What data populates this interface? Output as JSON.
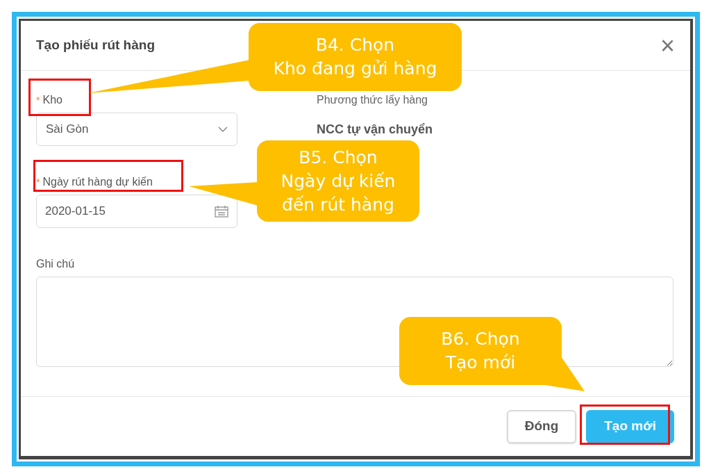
{
  "dialog": {
    "title": "Tạo phiếu rút hàng",
    "close": "×"
  },
  "fields": {
    "warehouse": {
      "required_mark": "*",
      "label": "Kho",
      "value": "Sài Gòn"
    },
    "method": {
      "label": "Phương thức lấy hàng",
      "value": "NCC tự vận chuyển"
    },
    "date": {
      "required_mark": "*",
      "label": "Ngày rút hàng dự kiến",
      "value": "2020-01-15"
    },
    "note": {
      "label": "Ghi chú"
    }
  },
  "buttons": [
    {
      "label": "Đóng",
      "kind": "secondary"
    },
    {
      "label": "Tạo mới",
      "kind": "primary"
    }
  ],
  "callouts": [
    {
      "lines": [
        "B4. Chọn",
        "Kho đang gửi hàng"
      ]
    },
    {
      "lines": [
        "B5. Chọn",
        "Ngày dự kiến",
        "đến rút hàng"
      ]
    },
    {
      "lines": [
        "B6. Chọn",
        "Tạo mới"
      ]
    }
  ]
}
